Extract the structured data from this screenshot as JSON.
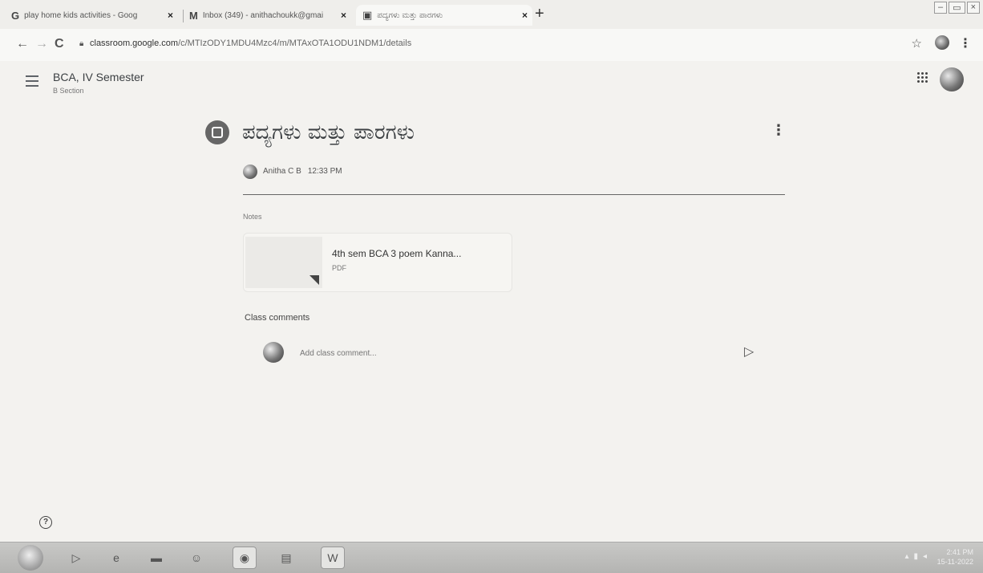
{
  "browser": {
    "tabs": [
      {
        "icon": "G",
        "title": "play home kids activities - Goog",
        "close": "×"
      },
      {
        "icon": "M",
        "title": "Inbox (349) - anithachoukk@gmai",
        "close": "×"
      },
      {
        "icon": "▣",
        "title": "ಪದ್ಯಗಳು ಮತ್ತು ಪಾರಗಳು",
        "close": "×"
      }
    ],
    "new_tab": "+",
    "url_host": "classroom.google.com",
    "url_path": "/c/MTIzODY1MDU4Mzc4/m/MTAxOTA1ODU1NDM1/details",
    "window_controls": [
      "‒",
      "▭",
      "×"
    ]
  },
  "header": {
    "course_title": "BCA, IV Semester",
    "course_section": "B Section"
  },
  "post": {
    "title": "ಪದ್ಯಗಳು ಮತ್ತು ಪಾರಗಳು",
    "author": "Anitha C B",
    "time": "12:33 PM",
    "notes_label": "Notes",
    "attachment": {
      "name": "4th sem BCA 3 poem Kanna...",
      "type": "PDF"
    },
    "comments_label": "Class comments",
    "comment_placeholder": "Add class comment..."
  },
  "taskbar": {
    "clock_time": "2:41 PM",
    "clock_date": "15-11-2022"
  }
}
